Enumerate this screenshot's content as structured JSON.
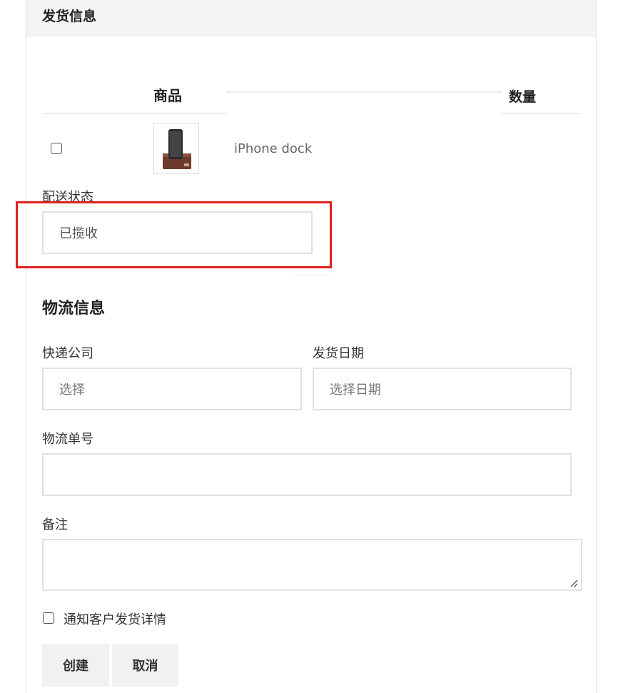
{
  "panel": {
    "title": "发货信息"
  },
  "table": {
    "header_product": "商品",
    "header_quantity": "数量",
    "rows": [
      {
        "name": "iPhone dock"
      }
    ]
  },
  "delivery_status": {
    "label": "配送状态",
    "value": "已揽收"
  },
  "logistics": {
    "title": "物流信息",
    "carrier_label": "快递公司",
    "carrier_placeholder": "选择",
    "ship_date_label": "发货日期",
    "ship_date_placeholder": "选择日期",
    "tracking_label": "物流单号",
    "tracking_value": "",
    "notes_label": "备注",
    "notes_value": ""
  },
  "notify": {
    "label": "通知客户发货详情",
    "checked": false
  },
  "actions": {
    "create_label": "创建",
    "cancel_label": "取消"
  },
  "colors": {
    "highlight": "#e0201c",
    "panel_header_bg": "#f4f4f4"
  }
}
